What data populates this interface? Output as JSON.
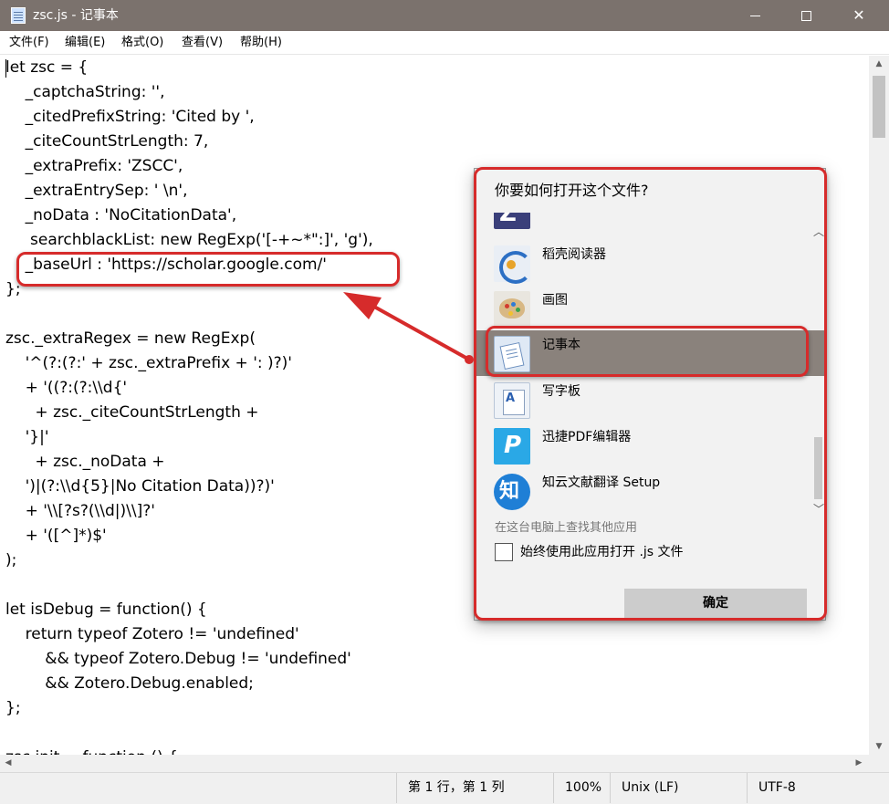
{
  "window": {
    "title": "zsc.js - 记事本",
    "controls": {
      "minimize": "",
      "maximize": "",
      "close": "✕"
    }
  },
  "menu": [
    {
      "label": "文件(F)"
    },
    {
      "label": "编辑(E)"
    },
    {
      "label": "格式(O)"
    },
    {
      "label": "查看(V)"
    },
    {
      "label": "帮助(H)"
    }
  ],
  "editor": {
    "lines": [
      "let zsc = {",
      "    _captchaString: '',",
      "    _citedPrefixString: 'Cited by ',",
      "    _citeCountStrLength: 7,",
      "    _extraPrefix: 'ZSCC',",
      "    _extraEntrySep: ' \\n',",
      "    _noData : 'NoCitationData',",
      "     searchblackList: new RegExp('[-+~*\":]', 'g'),",
      "    _baseUrl : 'https://scholar.google.com/'",
      "};",
      "",
      "zsc._extraRegex = new RegExp(",
      "    '^(?:(?:' + zsc._extraPrefix + ': )?)'",
      "    + '((?:(?:\\\\d{'",
      "      + zsc._citeCountStrLength +",
      "    '}|'",
      "      + zsc._noData +",
      "    ')|(?:\\\\d{5}|No Citation Data))?)'",
      "    + '\\\\[?s?(\\\\d|)\\\\]?'",
      "    + '([^]*)$'",
      ");",
      "",
      "let isDebug = function() {",
      "    return typeof Zotero != 'undefined'",
      "        && typeof Zotero.Debug != 'undefined'",
      "        && Zotero.Debug.enabled;",
      "};",
      "",
      "zsc.init = function () {"
    ]
  },
  "statusbar": {
    "position": "第 1 行，第 1 列",
    "zoom": "100%",
    "line_ending": "Unix (LF)",
    "encoding": "UTF-8"
  },
  "dialog": {
    "title": "你要如何打开这个文件?",
    "apps": [
      {
        "name": "",
        "icon": "zotero-icon"
      },
      {
        "name": "稻壳阅读器",
        "icon": "caj-reader-icon"
      },
      {
        "name": "画图",
        "icon": "paint-icon"
      },
      {
        "name": "记事本",
        "icon": "notepad-icon",
        "selected": true
      },
      {
        "name": "写字板",
        "icon": "wordpad-icon"
      },
      {
        "name": "迅捷PDF编辑器",
        "icon": "pdf-editor-icon"
      },
      {
        "name": "知云文献翻译 Setup",
        "icon": "zhiyun-icon"
      }
    ],
    "more_apps_link": "在这台电脑上查找其他应用",
    "always_use_label": "始终使用此应用打开 .js 文件",
    "always_use_checked": false,
    "ok_label": "确定"
  },
  "colors": {
    "titlebar": "#7b726d",
    "annotation": "#d62b2b",
    "selected_row": "#8a827c"
  }
}
